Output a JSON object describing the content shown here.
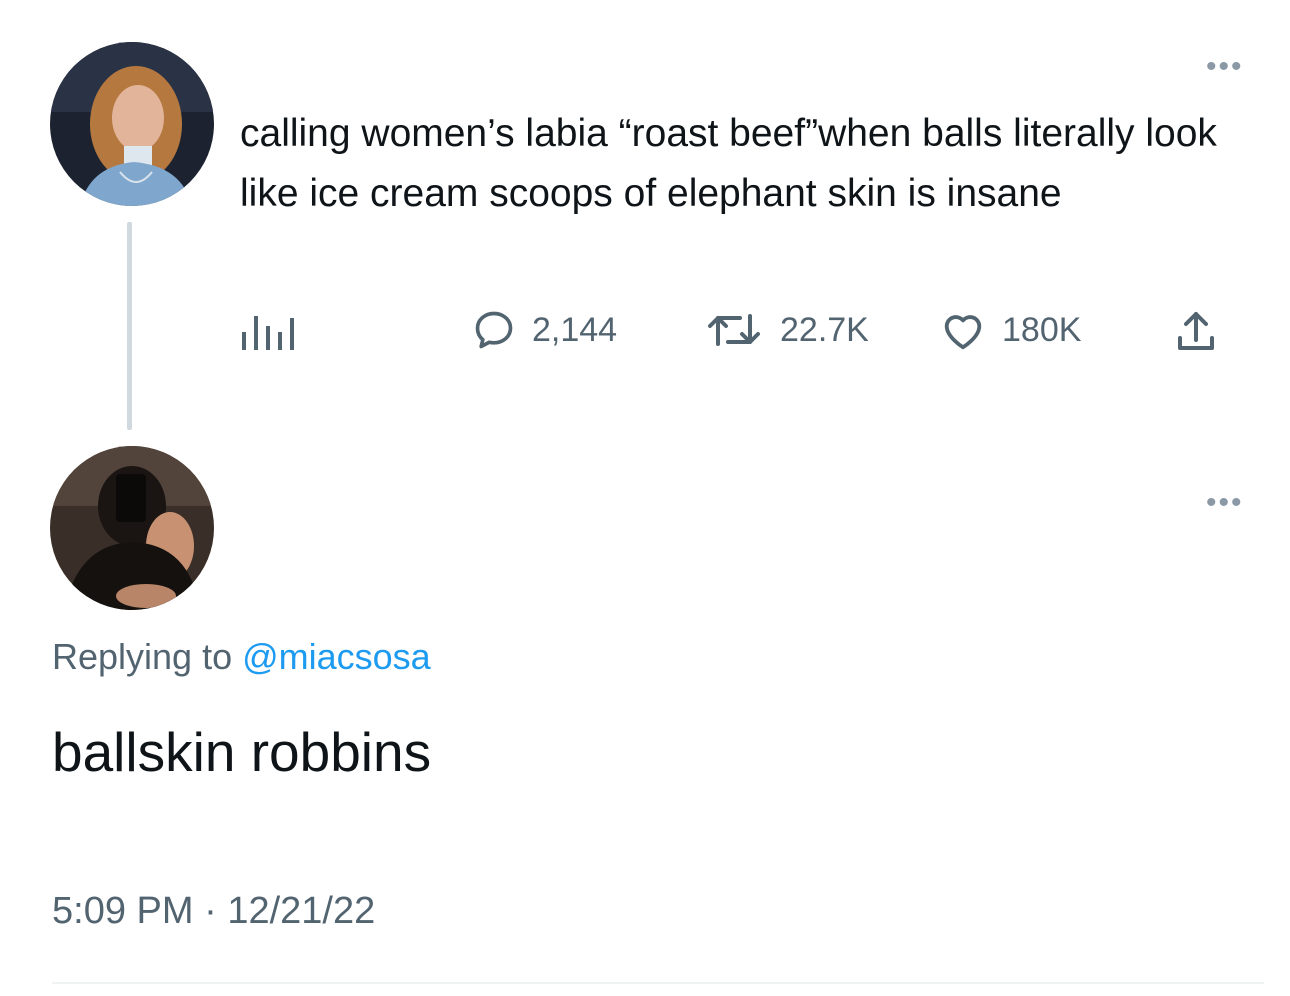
{
  "original_tweet": {
    "text": "calling women’s labia “roast beef”when balls literally look like ice cream scoops of elephant skin is insane",
    "metrics": {
      "analytics_icon": "bar-chart-icon",
      "replies": "2,144",
      "retweets": "22.7K",
      "likes": "180K"
    }
  },
  "reply_tweet": {
    "replying_to_prefix": "Replying to ",
    "replying_to_handle": "@miacsosa",
    "text": "ballskin robbins",
    "time": "5:09 PM",
    "separator": "·",
    "date": "12/21/22"
  },
  "more_glyph": "•••",
  "colors": {
    "text": "#0f1419",
    "secondary": "#536471",
    "link": "#1d9bf0",
    "thread_line": "#cfd9de"
  }
}
